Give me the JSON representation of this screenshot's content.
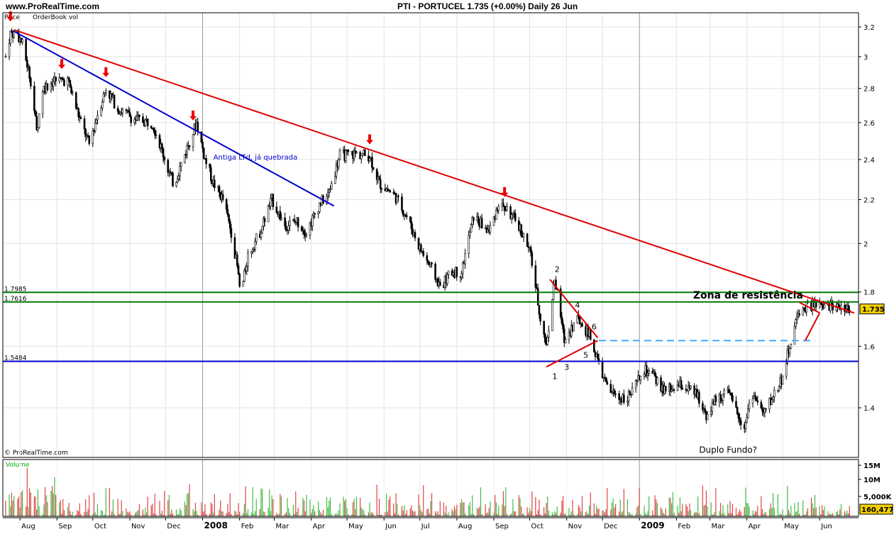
{
  "header": {
    "site": "www.ProRealTime.com",
    "title": "PTI - PORTUCEL    1.735 (+0.00%)   Daily  26 Jun",
    "legend_price": "Price",
    "legend_orderbook": "OrderBook vol",
    "copyright": "© ProRealTime.com"
  },
  "chart_data": {
    "type": "candlestick",
    "instrument": "PTI - PORTUCEL",
    "last_price": "1.735",
    "last_change": "+0.00%",
    "period": "Daily",
    "date": "26 Jun",
    "y_axis": {
      "scale": "log",
      "ticks": [
        "3.2",
        "3",
        "2.8",
        "2.6",
        "2.4",
        "2.2",
        "2",
        "1.8",
        "1.6",
        "1.4"
      ]
    },
    "x_axis": {
      "ticks": [
        "Aug",
        "Sep",
        "Oct",
        "Nov",
        "Dec",
        "2008",
        "Feb",
        "Mar",
        "Apr",
        "May",
        "Jun",
        "Jul",
        "Aug",
        "Sep",
        "Oct",
        "Nov",
        "Dec",
        "2009",
        "Feb",
        "Mar",
        "Apr",
        "May",
        "Jun"
      ]
    },
    "price_path": [
      [
        "2007-07-20",
        3.0
      ],
      [
        "2007-07-24",
        3.16
      ],
      [
        "2007-07-30",
        3.15
      ],
      [
        "2007-08-03",
        3.08
      ],
      [
        "2007-08-10",
        2.85
      ],
      [
        "2007-08-15",
        2.55
      ],
      [
        "2007-08-20",
        2.8
      ],
      [
        "2007-08-30",
        2.85
      ],
      [
        "2007-09-10",
        2.85
      ],
      [
        "2007-09-20",
        2.62
      ],
      [
        "2007-09-28",
        2.48
      ],
      [
        "2007-10-05",
        2.65
      ],
      [
        "2007-10-12",
        2.8
      ],
      [
        "2007-10-22",
        2.68
      ],
      [
        "2007-11-05",
        2.62
      ],
      [
        "2007-11-20",
        2.6
      ],
      [
        "2007-12-03",
        2.35
      ],
      [
        "2007-12-08",
        2.27
      ],
      [
        "2007-12-20",
        2.48
      ],
      [
        "2007-12-27",
        2.6
      ],
      [
        "2008-01-03",
        2.4
      ],
      [
        "2008-01-10",
        2.28
      ],
      [
        "2008-01-18",
        2.2
      ],
      [
        "2008-01-25",
        2.05
      ],
      [
        "2008-01-30",
        1.9
      ],
      [
        "2008-02-02",
        1.78
      ],
      [
        "2008-02-08",
        1.95
      ],
      [
        "2008-02-18",
        2.05
      ],
      [
        "2008-02-28",
        2.2
      ],
      [
        "2008-03-10",
        2.08
      ],
      [
        "2008-03-20",
        2.1
      ],
      [
        "2008-03-28",
        2.05
      ],
      [
        "2008-04-08",
        2.18
      ],
      [
        "2008-04-15",
        2.22
      ],
      [
        "2008-04-25",
        2.42
      ],
      [
        "2008-05-08",
        2.43
      ],
      [
        "2008-05-20",
        2.42
      ],
      [
        "2008-05-28",
        2.28
      ],
      [
        "2008-06-10",
        2.22
      ],
      [
        "2008-06-20",
        2.12
      ],
      [
        "2008-07-01",
        1.98
      ],
      [
        "2008-07-10",
        1.9
      ],
      [
        "2008-07-18",
        1.82
      ],
      [
        "2008-07-28",
        1.88
      ],
      [
        "2008-08-05",
        1.88
      ],
      [
        "2008-08-15",
        2.12
      ],
      [
        "2008-08-28",
        2.05
      ],
      [
        "2008-09-05",
        2.18
      ],
      [
        "2008-09-12",
        2.15
      ],
      [
        "2008-09-22",
        2.08
      ],
      [
        "2008-10-02",
        1.95
      ],
      [
        "2008-10-10",
        1.7
      ],
      [
        "2008-10-15",
        1.6
      ],
      [
        "2008-10-22",
        1.85
      ],
      [
        "2008-10-30",
        1.62
      ],
      [
        "2008-11-10",
        1.7
      ],
      [
        "2008-11-20",
        1.64
      ],
      [
        "2008-11-27",
        1.55
      ],
      [
        "2008-12-05",
        1.46
      ],
      [
        "2008-12-15",
        1.43
      ],
      [
        "2008-12-25",
        1.44
      ],
      [
        "2009-01-05",
        1.52
      ],
      [
        "2009-01-12",
        1.5
      ],
      [
        "2009-01-22",
        1.45
      ],
      [
        "2009-02-05",
        1.47
      ],
      [
        "2009-02-18",
        1.44
      ],
      [
        "2009-02-26",
        1.38
      ],
      [
        "2009-03-05",
        1.42
      ],
      [
        "2009-03-15",
        1.45
      ],
      [
        "2009-03-25",
        1.38
      ],
      [
        "2009-03-30",
        1.34
      ],
      [
        "2009-04-05",
        1.45
      ],
      [
        "2009-04-15",
        1.38
      ],
      [
        "2009-04-25",
        1.45
      ],
      [
        "2009-05-01",
        1.5
      ],
      [
        "2009-05-08",
        1.62
      ],
      [
        "2009-05-15",
        1.73
      ],
      [
        "2009-05-25",
        1.75
      ],
      [
        "2009-06-05",
        1.74
      ],
      [
        "2009-06-15",
        1.75
      ],
      [
        "2009-06-26",
        1.735
      ]
    ],
    "horizontal_lines": [
      {
        "value": 1.7985,
        "label": "1.7985",
        "color": "#007a00"
      },
      {
        "value": 1.7616,
        "label": "1.7616",
        "color": "#007a00"
      },
      {
        "value": 1.5484,
        "label": "1.5484",
        "color": "#0000cc"
      },
      {
        "value": 1.62,
        "label": "",
        "color": "#44aaff",
        "style": "dashed",
        "from": "2008-11-28",
        "to": "2009-05-28"
      }
    ],
    "trendlines": [
      {
        "color": "#dd0000",
        "from": [
          "2007-07-27",
          3.18
        ],
        "to": [
          "2009-06-30",
          1.72
        ]
      },
      {
        "color": "#0000cc",
        "from": [
          "2007-07-27",
          3.17
        ],
        "to": [
          "2008-04-20",
          2.17
        ]
      },
      {
        "color": "#dd0000",
        "from": [
          "2008-10-18",
          1.85
        ],
        "to": [
          "2008-11-27",
          1.63
        ]
      },
      {
        "color": "#dd0000",
        "from": [
          "2008-10-15",
          1.53
        ],
        "to": [
          "2008-11-27",
          1.62
        ]
      },
      {
        "color": "#dd0000",
        "from": [
          "2009-05-20",
          1.62
        ],
        "to": [
          "2009-06-01",
          1.72
        ]
      },
      {
        "color": "#dd0000",
        "from": [
          "2009-05-15",
          1.76
        ],
        "to": [
          "2009-06-01",
          1.72
        ]
      }
    ],
    "arrows": [
      "2007-07-24",
      "2007-09-05",
      "2007-10-12",
      "2007-12-24",
      "2008-05-20",
      "2008-09-10"
    ],
    "annotations": [
      {
        "text": "Antiga LTd, já quebrada",
        "x": "2008-01-10",
        "y": 2.4,
        "color": "#0000cc"
      },
      {
        "text": "Zona de resistência",
        "x": "2009-02-15",
        "y": 1.775,
        "color": "#000000",
        "bold": true
      },
      {
        "text": "Duplo Fundo?",
        "x": "2009-02-20",
        "y": 1.27,
        "color": "#000000"
      },
      {
        "text": "1",
        "x": "2008-10-20",
        "y": 1.49,
        "color": "#000000"
      },
      {
        "text": "2",
        "x": "2008-10-22",
        "y": 1.88,
        "color": "#000000"
      },
      {
        "text": "3",
        "x": "2008-10-30",
        "y": 1.52,
        "color": "#000000"
      },
      {
        "text": "4",
        "x": "2008-11-08",
        "y": 1.74,
        "color": "#000000"
      },
      {
        "text": "5",
        "x": "2008-11-15",
        "y": 1.56,
        "color": "#000000"
      },
      {
        "text": "6",
        "x": "2008-11-22",
        "y": 1.66,
        "color": "#000000"
      }
    ],
    "volume": {
      "label": "Volume",
      "ticks": [
        "15M",
        "10M",
        "5,000K"
      ],
      "last_value": "160,477"
    }
  }
}
